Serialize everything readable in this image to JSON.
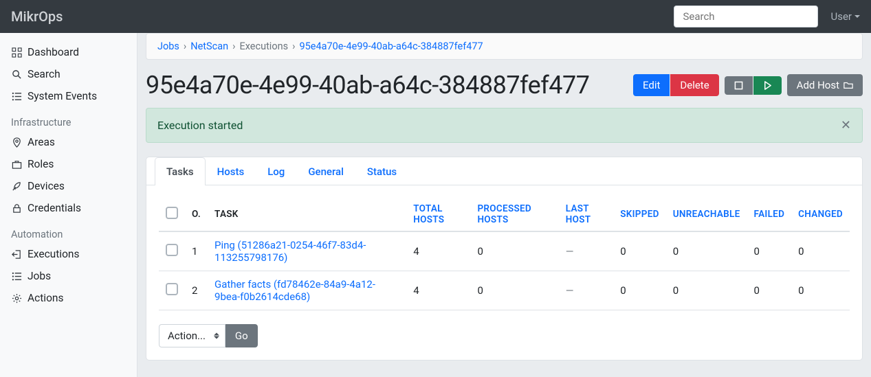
{
  "brand": "MikrOps",
  "search_placeholder": "Search",
  "user_label": "User",
  "sidebar": {
    "items": [
      {
        "icon": "grid-icon",
        "label": "Dashboard"
      },
      {
        "icon": "search-icon",
        "label": "Search"
      },
      {
        "icon": "list-icon",
        "label": "System Events"
      }
    ],
    "sections": [
      {
        "title": "Infrastructure",
        "items": [
          {
            "icon": "pin-icon",
            "label": "Areas"
          },
          {
            "icon": "briefcase-icon",
            "label": "Roles"
          },
          {
            "icon": "rocket-icon",
            "label": "Devices"
          },
          {
            "icon": "lock-icon",
            "label": "Credentials"
          }
        ]
      },
      {
        "title": "Automation",
        "items": [
          {
            "icon": "exit-icon",
            "label": "Executions"
          },
          {
            "icon": "list-icon",
            "label": "Jobs"
          },
          {
            "icon": "gear-icon",
            "label": "Actions"
          }
        ]
      }
    ]
  },
  "breadcrumb": {
    "jobs": "Jobs",
    "netscan": "NetScan",
    "executions": "Executions",
    "current": "95e4a70e-4e99-40ab-a64c-384887fef477"
  },
  "page_title": "95e4a70e-4e99-40ab-a64c-384887fef477",
  "buttons": {
    "edit": "Edit",
    "delete": "Delete",
    "add_host": "Add Host"
  },
  "alert": {
    "message": "Execution started"
  },
  "tabs": [
    {
      "label": "Tasks",
      "active": true
    },
    {
      "label": "Hosts",
      "active": false
    },
    {
      "label": "Log",
      "active": false
    },
    {
      "label": "General",
      "active": false
    },
    {
      "label": "Status",
      "active": false
    }
  ],
  "table": {
    "headers": {
      "order": "O.",
      "task": "TASK",
      "total_hosts": "TOTAL HOSTS",
      "processed_hosts": "PROCESSED HOSTS",
      "last_host": "LAST HOST",
      "skipped": "SKIPPED",
      "unreachable": "UNREACHABLE",
      "failed": "FAILED",
      "changed": "CHANGED"
    },
    "rows": [
      {
        "order": "1",
        "task": "Ping (51286a21-0254-46f7-83d4-113255798176)",
        "total_hosts": "4",
        "processed_hosts": "0",
        "last_host": "—",
        "skipped": "0",
        "unreachable": "0",
        "failed": "0",
        "changed": "0"
      },
      {
        "order": "2",
        "task": "Gather facts (fd78462e-84a9-4a12-9bea-f0b2614cde68)",
        "total_hosts": "4",
        "processed_hosts": "0",
        "last_host": "—",
        "skipped": "0",
        "unreachable": "0",
        "failed": "0",
        "changed": "0"
      }
    ]
  },
  "actions_select": "Action...",
  "go_button": "Go"
}
